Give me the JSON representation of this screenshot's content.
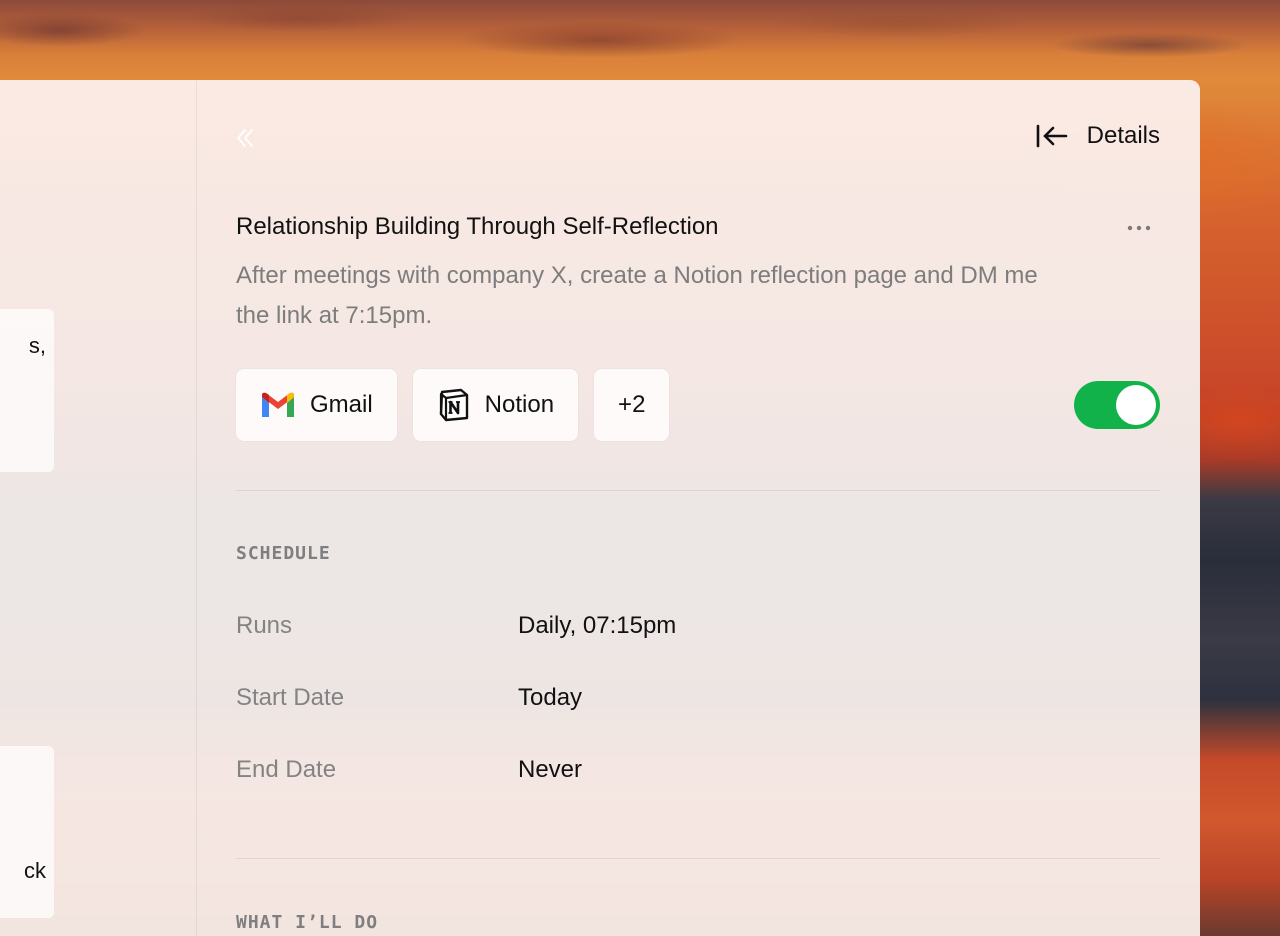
{
  "details_panel": {
    "header_title": "Details",
    "task": {
      "title": "Relationship Building Through Self-Reflection",
      "description": "After meetings with company X, create a Notion reflection page and DM me the link at 7:15pm."
    },
    "integrations": [
      {
        "label": "Gmail",
        "icon": "gmail-icon"
      },
      {
        "label": "Notion",
        "icon": "notion-icon"
      }
    ],
    "more_integrations_label": "+2",
    "enabled": true,
    "schedule": {
      "section_label": "SCHEDULE",
      "rows": [
        {
          "label": "Runs",
          "value": "Daily, 07:15pm"
        },
        {
          "label": "Start Date",
          "value": "Today"
        },
        {
          "label": "End Date",
          "value": "Never"
        }
      ]
    },
    "next_section_label": "WHAT I’LL DO"
  },
  "left_list": {
    "card_fragments": [
      "s,",
      "ck"
    ]
  },
  "colors": {
    "toggle_on": "#12b24a",
    "text_primary": "#111111",
    "text_muted": "#7d7d7d"
  }
}
